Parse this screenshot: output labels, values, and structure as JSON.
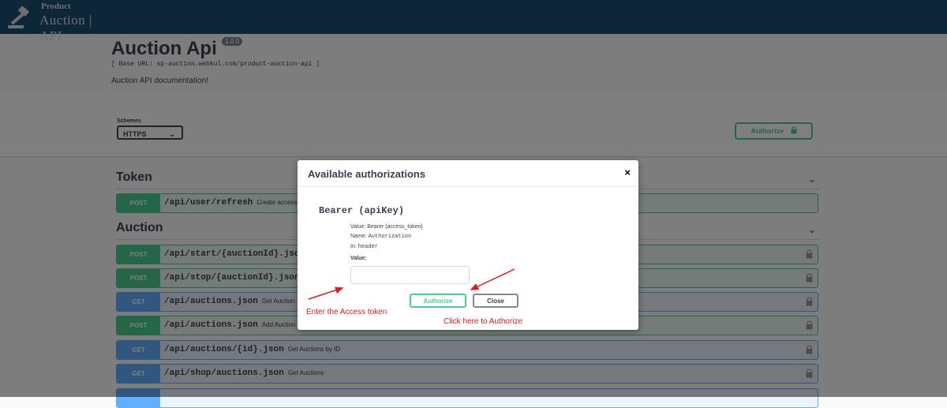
{
  "header": {
    "logo_small": "Product",
    "logo_big": "Auction | API",
    "logo_icon": "gavel-icon",
    "bg_color": "#1b4f72"
  },
  "info": {
    "title": "Auction Api",
    "version": "1.0.0",
    "base_url": "[ Base URL: sp-auction.webkul.com/product-auction-api ]",
    "description": "Auction API documentation!"
  },
  "schemes": {
    "label": "Schemes",
    "selected": "HTTPS",
    "authorize_label": "Authorize"
  },
  "sections": [
    {
      "title": "Token",
      "operations": [
        {
          "method": "POST",
          "path": "/api/user/refresh",
          "summary": "Create access"
        }
      ]
    },
    {
      "title": "Auction",
      "operations": [
        {
          "method": "POST",
          "path": "/api/start/{auctionId}.json",
          "summary": ""
        },
        {
          "method": "POST",
          "path": "/api/stop/{auctionId}.json",
          "summary": ""
        },
        {
          "method": "GET",
          "path": "/api/auctions.json",
          "summary": "Get Auction"
        },
        {
          "method": "POST",
          "path": "/api/auctions.json",
          "summary": "Add Auction"
        },
        {
          "method": "GET",
          "path": "/api/auctions/{id}.json",
          "summary": "Get Auctions by ID"
        },
        {
          "method": "GET",
          "path": "/api/shop/auctions.json",
          "summary": "Get Auctions"
        }
      ]
    }
  ],
  "modal": {
    "title": "Available authorizations",
    "close_symbol": "×",
    "auth_name": "Bearer  (apiKey)",
    "value_line_label": "Value: ",
    "value_line_value": "Bearer {access_token}",
    "name_line_label": "Name: ",
    "name_line_value": "Authorization",
    "in_line_label": "In: ",
    "in_line_value": "header",
    "value_label": "Value:",
    "value_input": "",
    "authorize_label": "Authorize",
    "close_label": "Close"
  },
  "annotations": {
    "enter_token": "Enter the Access token",
    "click_authorize": "Click here to Authorize",
    "color": "#e0191b"
  },
  "colors": {
    "post": "#49cc90",
    "get": "#61affe"
  }
}
